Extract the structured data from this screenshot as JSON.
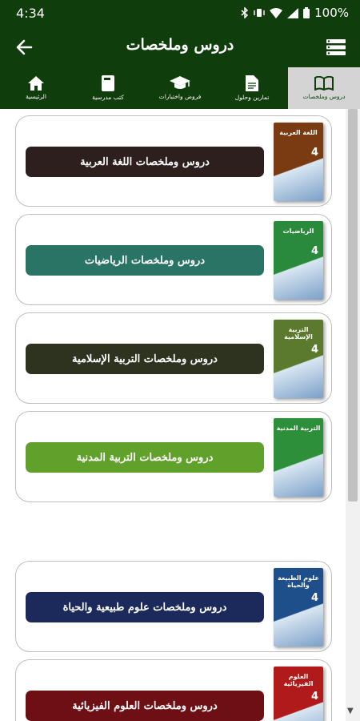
{
  "status": {
    "time": "4:34",
    "battery": "100%"
  },
  "header": {
    "title": "دروس وملخصات"
  },
  "tabs": [
    {
      "label": "دروس وملخصات",
      "icon": "book-open-icon"
    },
    {
      "label": "تمارين وحلول",
      "icon": "document-icon"
    },
    {
      "label": "فروض واختبارات",
      "icon": "graduation-cap-icon"
    },
    {
      "label": "كتب مدرسية",
      "icon": "book-icon"
    },
    {
      "label": "الرئيسية",
      "icon": "home-icon"
    }
  ],
  "cards": [
    {
      "label": "دروس وملخصات اللغة العربية",
      "color": "#2e1f1f",
      "cover_title": "اللغة العربية",
      "cover_color": "#7a3a12",
      "cover_num": "4"
    },
    {
      "label": "دروس وملخصات الرياضيات",
      "color": "#2a7466",
      "cover_title": "الرياضيات",
      "cover_color": "#2a8a3c",
      "cover_num": "4"
    },
    {
      "label": "دروس وملخصات التربية الإسلامية",
      "color": "#2e3320",
      "cover_title": "التربية الإسلامية",
      "cover_color": "#5b7a2e",
      "cover_num": "4"
    },
    {
      "label": "دروس وملخصات التربية المدنية",
      "color": "#5fa12a",
      "cover_title": "التربية المدنية",
      "cover_color": "#2d8f3a",
      "cover_num": ""
    },
    {
      "label": "دروس وملخصات علوم طبيعية والحياة",
      "color": "#1c2a5b",
      "cover_title": "علوم الطبيعة والحياة",
      "cover_color": "#1e4f8a",
      "cover_num": "4"
    },
    {
      "label": "دروس وملخصات العلوم الفيزيائية",
      "color": "#6e0f14",
      "cover_title": "العلوم الفيزيائية",
      "cover_color": "#b01a1a",
      "cover_num": "4"
    }
  ]
}
